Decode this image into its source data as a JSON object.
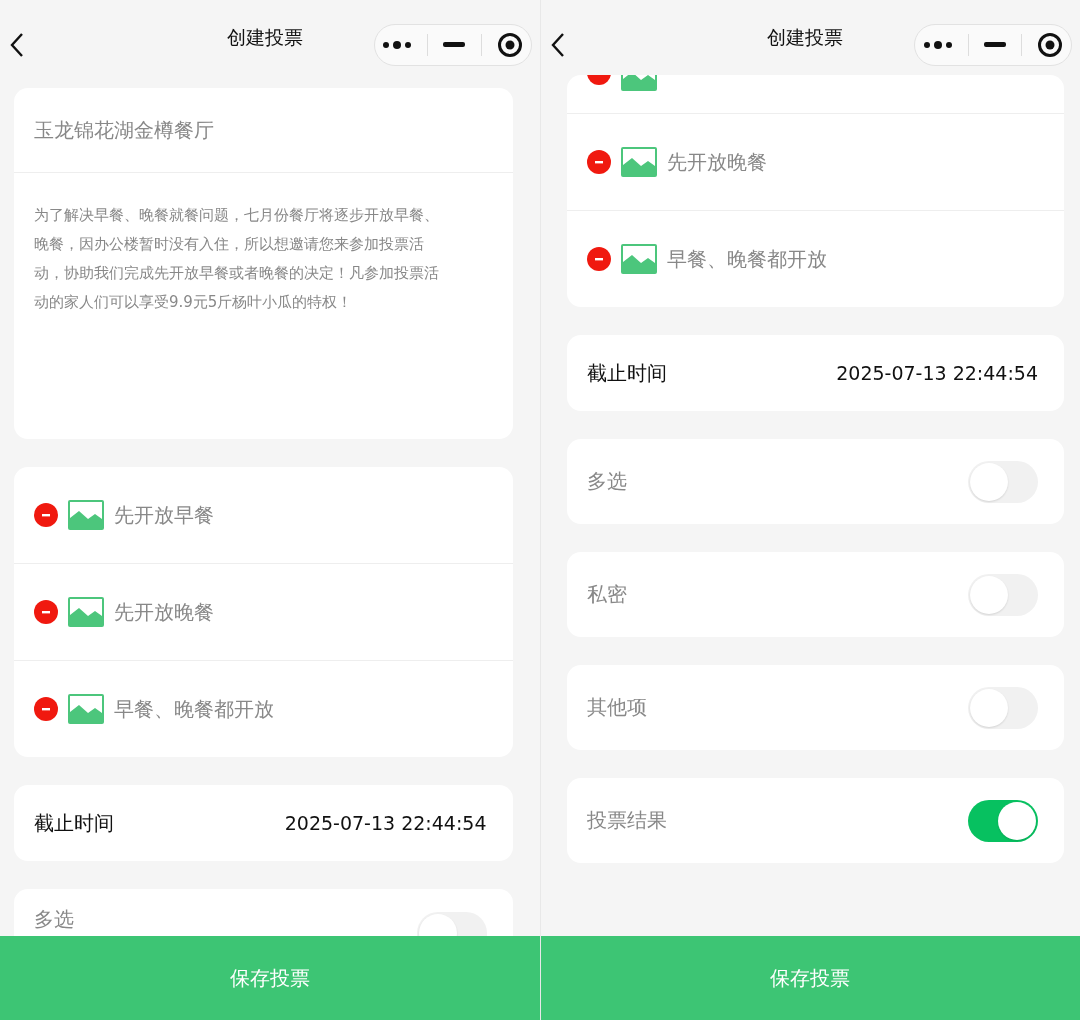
{
  "screens": [
    {
      "title": "创建投票",
      "poll_title": "玉龙锦花湖金樽餐厅",
      "description": "为了解决早餐、晚餐就餐问题，七月份餐厅将逐步开放早餐、晚餐，因办公楼暂时没有入住，所以想邀请您来参加投票活动，协助我们完成先开放早餐或者晚餐的决定！凡参加投票活动的家人们可以享受9.9元5斤杨叶小瓜的特权！",
      "options": [
        {
          "kind": "full",
          "label": "先开放早餐"
        },
        {
          "kind": "full",
          "label": "先开放晚餐"
        },
        {
          "kind": "full",
          "label": "早餐、晚餐都开放"
        }
      ],
      "deadline": {
        "label": "截止时间",
        "value": "2025-07-13 22:44:54"
      },
      "settings": [
        {
          "kind": "clipped",
          "label": "多选",
          "on": false
        }
      ],
      "save_button": "保存投票"
    },
    {
      "title": "创建投票",
      "options": [
        {
          "kind": "clipped"
        },
        {
          "kind": "full",
          "label": "先开放晚餐"
        },
        {
          "kind": "full",
          "label": "早餐、晚餐都开放"
        }
      ],
      "deadline": {
        "label": "截止时间",
        "value": "2025-07-13 22:44:54"
      },
      "settings": [
        {
          "kind": "full",
          "label": "多选",
          "on": false
        },
        {
          "kind": "full",
          "label": "私密",
          "on": false
        },
        {
          "kind": "full",
          "label": "其他项",
          "on": false
        },
        {
          "kind": "full",
          "label": "投票结果",
          "on": true
        }
      ],
      "save_button": "保存投票"
    }
  ]
}
